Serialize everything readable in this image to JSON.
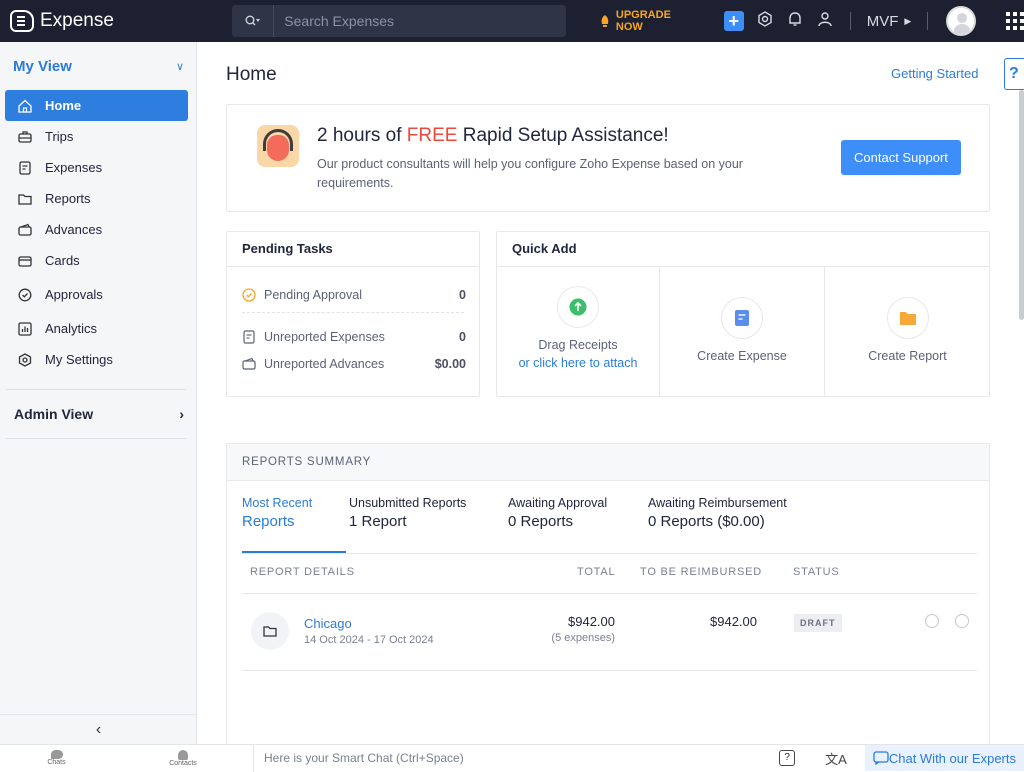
{
  "app": {
    "brand": "Expense"
  },
  "topbar": {
    "search_placeholder": "Search Expenses",
    "upgrade_label": "UPGRADE NOW",
    "org_label": "MVF"
  },
  "sidebar": {
    "my_view_label": "My View",
    "items": [
      {
        "label": "Home",
        "icon": "home-icon"
      },
      {
        "label": "Trips",
        "icon": "briefcase-icon"
      },
      {
        "label": "Expenses",
        "icon": "receipt-icon"
      },
      {
        "label": "Reports",
        "icon": "folder-icon"
      },
      {
        "label": "Advances",
        "icon": "wallet-icon"
      },
      {
        "label": "Cards",
        "icon": "card-icon"
      },
      {
        "label": "Approvals",
        "icon": "check-circle-icon"
      },
      {
        "label": "Analytics",
        "icon": "chart-icon"
      },
      {
        "label": "My Settings",
        "icon": "gear-icon"
      }
    ],
    "admin_view_label": "Admin View"
  },
  "main": {
    "title": "Home",
    "getting_started": "Getting Started",
    "help": "?"
  },
  "promo": {
    "title_pre": "2 hours of ",
    "title_free": "FREE",
    "title_post": " Rapid Setup Assistance!",
    "text": "Our product consultants will help you configure Zoho Expense based on your requirements.",
    "button": "Contact Support"
  },
  "pending_tasks": {
    "title": "Pending Tasks",
    "rows": [
      {
        "label": "Pending Approval",
        "value": "0"
      },
      {
        "label": "Unreported Expenses",
        "value": "0"
      },
      {
        "label": "Unreported Advances",
        "value": "$0.00"
      }
    ]
  },
  "quick_add": {
    "title": "Quick Add",
    "drag_label": "Drag Receipts",
    "drag_link": "or click here to attach",
    "create_expense": "Create Expense",
    "create_report": "Create Report"
  },
  "reports_summary": {
    "title": "REPORTS SUMMARY",
    "tabs": [
      {
        "a": "Most Recent",
        "b": "Reports"
      },
      {
        "a": "Unsubmitted Reports",
        "b": "1 Report"
      },
      {
        "a": "Awaiting Approval",
        "b": "0 Reports"
      },
      {
        "a": "Awaiting Reimbursement",
        "b": "0 Reports ($0.00)"
      }
    ],
    "columns": {
      "details": "REPORT DETAILS",
      "total": "TOTAL",
      "reimbursed": "TO BE REIMBURSED",
      "status": "STATUS"
    },
    "rows": [
      {
        "name": "Chicago",
        "dates": "14 Oct 2024 - 17 Oct 2024",
        "total": "$942.00",
        "count": "(5 expenses)",
        "reimbursed": "$942.00",
        "status": "DRAFT"
      }
    ]
  },
  "bottombar": {
    "chats": "Chats",
    "contacts": "Contacts",
    "smart_chat": "Here is your Smart Chat (Ctrl+Space)",
    "experts": "Chat With our Experts"
  },
  "colors": {
    "accent": "#2e7ee0",
    "topbar": "#1c2030",
    "upgrade": "#f5a623",
    "free": "#e84b3c"
  }
}
